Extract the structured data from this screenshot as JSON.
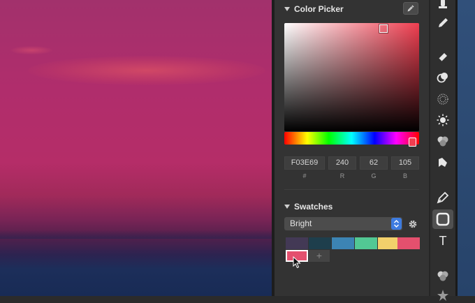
{
  "color_picker": {
    "title": "Color Picker",
    "hex": "F03E69",
    "r": "240",
    "g": "62",
    "b": "105",
    "labels": {
      "hex": "#",
      "r": "R",
      "g": "G",
      "b": "B"
    }
  },
  "swatches": {
    "title": "Swatches",
    "selected_set": "Bright",
    "colors": [
      "#433955",
      "#1e3e4c",
      "#3c84b4",
      "#52c894",
      "#f2d06b",
      "#e4506e",
      "#e4506e"
    ],
    "add_label": "+"
  },
  "toolbar": {
    "text_tool_glyph": "T",
    "tools": [
      "stamp-icon",
      "pencil-icon",
      "eraser-icon",
      "blend-icon",
      "grain-icon",
      "light-icon",
      "blob-icon",
      "smudge-icon",
      "pen-icon",
      "shape-icon",
      "text-icon",
      "layers-icon",
      "star-icon"
    ]
  },
  "accent_color": "#3d7be0"
}
